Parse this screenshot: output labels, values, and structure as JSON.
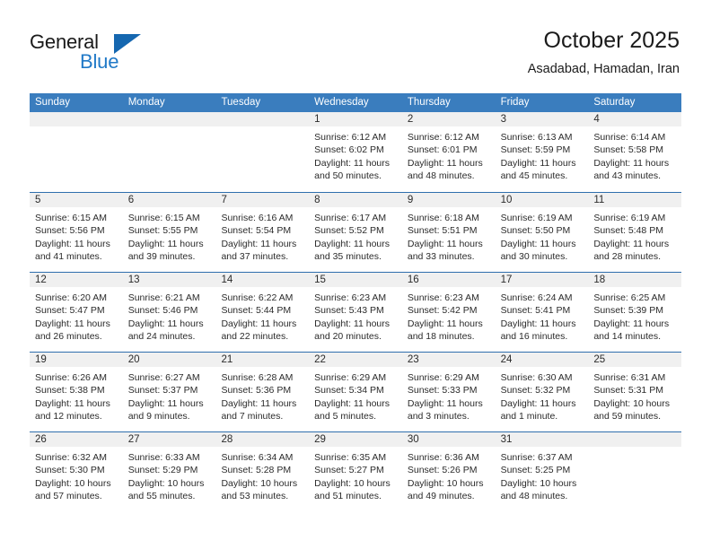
{
  "brand": {
    "word_one": "General",
    "word_two": "Blue",
    "accent_color": "#1567b0",
    "blue_text_color": "#2079c7"
  },
  "header": {
    "title": "October 2025",
    "location": "Asadabad, Hamadan, Iran"
  },
  "theme": {
    "header_bg": "#3a7dbe",
    "header_text": "#ffffff",
    "week_divider": "#2f6fad",
    "day_band_bg": "#f0f0f0",
    "body_text": "#2b2b2b"
  },
  "weekdays": [
    "Sunday",
    "Monday",
    "Tuesday",
    "Wednesday",
    "Thursday",
    "Friday",
    "Saturday"
  ],
  "weeks": [
    [
      {
        "day": "",
        "sunrise": "",
        "sunset": "",
        "daylight_a": "",
        "daylight_b": "",
        "empty": true
      },
      {
        "day": "",
        "sunrise": "",
        "sunset": "",
        "daylight_a": "",
        "daylight_b": "",
        "empty": true
      },
      {
        "day": "",
        "sunrise": "",
        "sunset": "",
        "daylight_a": "",
        "daylight_b": "",
        "empty": true
      },
      {
        "day": "1",
        "sunrise": "Sunrise: 6:12 AM",
        "sunset": "Sunset: 6:02 PM",
        "daylight_a": "Daylight: 11 hours",
        "daylight_b": "and 50 minutes.",
        "empty": false
      },
      {
        "day": "2",
        "sunrise": "Sunrise: 6:12 AM",
        "sunset": "Sunset: 6:01 PM",
        "daylight_a": "Daylight: 11 hours",
        "daylight_b": "and 48 minutes.",
        "empty": false
      },
      {
        "day": "3",
        "sunrise": "Sunrise: 6:13 AM",
        "sunset": "Sunset: 5:59 PM",
        "daylight_a": "Daylight: 11 hours",
        "daylight_b": "and 45 minutes.",
        "empty": false
      },
      {
        "day": "4",
        "sunrise": "Sunrise: 6:14 AM",
        "sunset": "Sunset: 5:58 PM",
        "daylight_a": "Daylight: 11 hours",
        "daylight_b": "and 43 minutes.",
        "empty": false
      }
    ],
    [
      {
        "day": "5",
        "sunrise": "Sunrise: 6:15 AM",
        "sunset": "Sunset: 5:56 PM",
        "daylight_a": "Daylight: 11 hours",
        "daylight_b": "and 41 minutes.",
        "empty": false
      },
      {
        "day": "6",
        "sunrise": "Sunrise: 6:15 AM",
        "sunset": "Sunset: 5:55 PM",
        "daylight_a": "Daylight: 11 hours",
        "daylight_b": "and 39 minutes.",
        "empty": false
      },
      {
        "day": "7",
        "sunrise": "Sunrise: 6:16 AM",
        "sunset": "Sunset: 5:54 PM",
        "daylight_a": "Daylight: 11 hours",
        "daylight_b": "and 37 minutes.",
        "empty": false
      },
      {
        "day": "8",
        "sunrise": "Sunrise: 6:17 AM",
        "sunset": "Sunset: 5:52 PM",
        "daylight_a": "Daylight: 11 hours",
        "daylight_b": "and 35 minutes.",
        "empty": false
      },
      {
        "day": "9",
        "sunrise": "Sunrise: 6:18 AM",
        "sunset": "Sunset: 5:51 PM",
        "daylight_a": "Daylight: 11 hours",
        "daylight_b": "and 33 minutes.",
        "empty": false
      },
      {
        "day": "10",
        "sunrise": "Sunrise: 6:19 AM",
        "sunset": "Sunset: 5:50 PM",
        "daylight_a": "Daylight: 11 hours",
        "daylight_b": "and 30 minutes.",
        "empty": false
      },
      {
        "day": "11",
        "sunrise": "Sunrise: 6:19 AM",
        "sunset": "Sunset: 5:48 PM",
        "daylight_a": "Daylight: 11 hours",
        "daylight_b": "and 28 minutes.",
        "empty": false
      }
    ],
    [
      {
        "day": "12",
        "sunrise": "Sunrise: 6:20 AM",
        "sunset": "Sunset: 5:47 PM",
        "daylight_a": "Daylight: 11 hours",
        "daylight_b": "and 26 minutes.",
        "empty": false
      },
      {
        "day": "13",
        "sunrise": "Sunrise: 6:21 AM",
        "sunset": "Sunset: 5:46 PM",
        "daylight_a": "Daylight: 11 hours",
        "daylight_b": "and 24 minutes.",
        "empty": false
      },
      {
        "day": "14",
        "sunrise": "Sunrise: 6:22 AM",
        "sunset": "Sunset: 5:44 PM",
        "daylight_a": "Daylight: 11 hours",
        "daylight_b": "and 22 minutes.",
        "empty": false
      },
      {
        "day": "15",
        "sunrise": "Sunrise: 6:23 AM",
        "sunset": "Sunset: 5:43 PM",
        "daylight_a": "Daylight: 11 hours",
        "daylight_b": "and 20 minutes.",
        "empty": false
      },
      {
        "day": "16",
        "sunrise": "Sunrise: 6:23 AM",
        "sunset": "Sunset: 5:42 PM",
        "daylight_a": "Daylight: 11 hours",
        "daylight_b": "and 18 minutes.",
        "empty": false
      },
      {
        "day": "17",
        "sunrise": "Sunrise: 6:24 AM",
        "sunset": "Sunset: 5:41 PM",
        "daylight_a": "Daylight: 11 hours",
        "daylight_b": "and 16 minutes.",
        "empty": false
      },
      {
        "day": "18",
        "sunrise": "Sunrise: 6:25 AM",
        "sunset": "Sunset: 5:39 PM",
        "daylight_a": "Daylight: 11 hours",
        "daylight_b": "and 14 minutes.",
        "empty": false
      }
    ],
    [
      {
        "day": "19",
        "sunrise": "Sunrise: 6:26 AM",
        "sunset": "Sunset: 5:38 PM",
        "daylight_a": "Daylight: 11 hours",
        "daylight_b": "and 12 minutes.",
        "empty": false
      },
      {
        "day": "20",
        "sunrise": "Sunrise: 6:27 AM",
        "sunset": "Sunset: 5:37 PM",
        "daylight_a": "Daylight: 11 hours",
        "daylight_b": "and 9 minutes.",
        "empty": false
      },
      {
        "day": "21",
        "sunrise": "Sunrise: 6:28 AM",
        "sunset": "Sunset: 5:36 PM",
        "daylight_a": "Daylight: 11 hours",
        "daylight_b": "and 7 minutes.",
        "empty": false
      },
      {
        "day": "22",
        "sunrise": "Sunrise: 6:29 AM",
        "sunset": "Sunset: 5:34 PM",
        "daylight_a": "Daylight: 11 hours",
        "daylight_b": "and 5 minutes.",
        "empty": false
      },
      {
        "day": "23",
        "sunrise": "Sunrise: 6:29 AM",
        "sunset": "Sunset: 5:33 PM",
        "daylight_a": "Daylight: 11 hours",
        "daylight_b": "and 3 minutes.",
        "empty": false
      },
      {
        "day": "24",
        "sunrise": "Sunrise: 6:30 AM",
        "sunset": "Sunset: 5:32 PM",
        "daylight_a": "Daylight: 11 hours",
        "daylight_b": "and 1 minute.",
        "empty": false
      },
      {
        "day": "25",
        "sunrise": "Sunrise: 6:31 AM",
        "sunset": "Sunset: 5:31 PM",
        "daylight_a": "Daylight: 10 hours",
        "daylight_b": "and 59 minutes.",
        "empty": false
      }
    ],
    [
      {
        "day": "26",
        "sunrise": "Sunrise: 6:32 AM",
        "sunset": "Sunset: 5:30 PM",
        "daylight_a": "Daylight: 10 hours",
        "daylight_b": "and 57 minutes.",
        "empty": false
      },
      {
        "day": "27",
        "sunrise": "Sunrise: 6:33 AM",
        "sunset": "Sunset: 5:29 PM",
        "daylight_a": "Daylight: 10 hours",
        "daylight_b": "and 55 minutes.",
        "empty": false
      },
      {
        "day": "28",
        "sunrise": "Sunrise: 6:34 AM",
        "sunset": "Sunset: 5:28 PM",
        "daylight_a": "Daylight: 10 hours",
        "daylight_b": "and 53 minutes.",
        "empty": false
      },
      {
        "day": "29",
        "sunrise": "Sunrise: 6:35 AM",
        "sunset": "Sunset: 5:27 PM",
        "daylight_a": "Daylight: 10 hours",
        "daylight_b": "and 51 minutes.",
        "empty": false
      },
      {
        "day": "30",
        "sunrise": "Sunrise: 6:36 AM",
        "sunset": "Sunset: 5:26 PM",
        "daylight_a": "Daylight: 10 hours",
        "daylight_b": "and 49 minutes.",
        "empty": false
      },
      {
        "day": "31",
        "sunrise": "Sunrise: 6:37 AM",
        "sunset": "Sunset: 5:25 PM",
        "daylight_a": "Daylight: 10 hours",
        "daylight_b": "and 48 minutes.",
        "empty": false
      },
      {
        "day": "",
        "sunrise": "",
        "sunset": "",
        "daylight_a": "",
        "daylight_b": "",
        "empty": true
      }
    ]
  ]
}
